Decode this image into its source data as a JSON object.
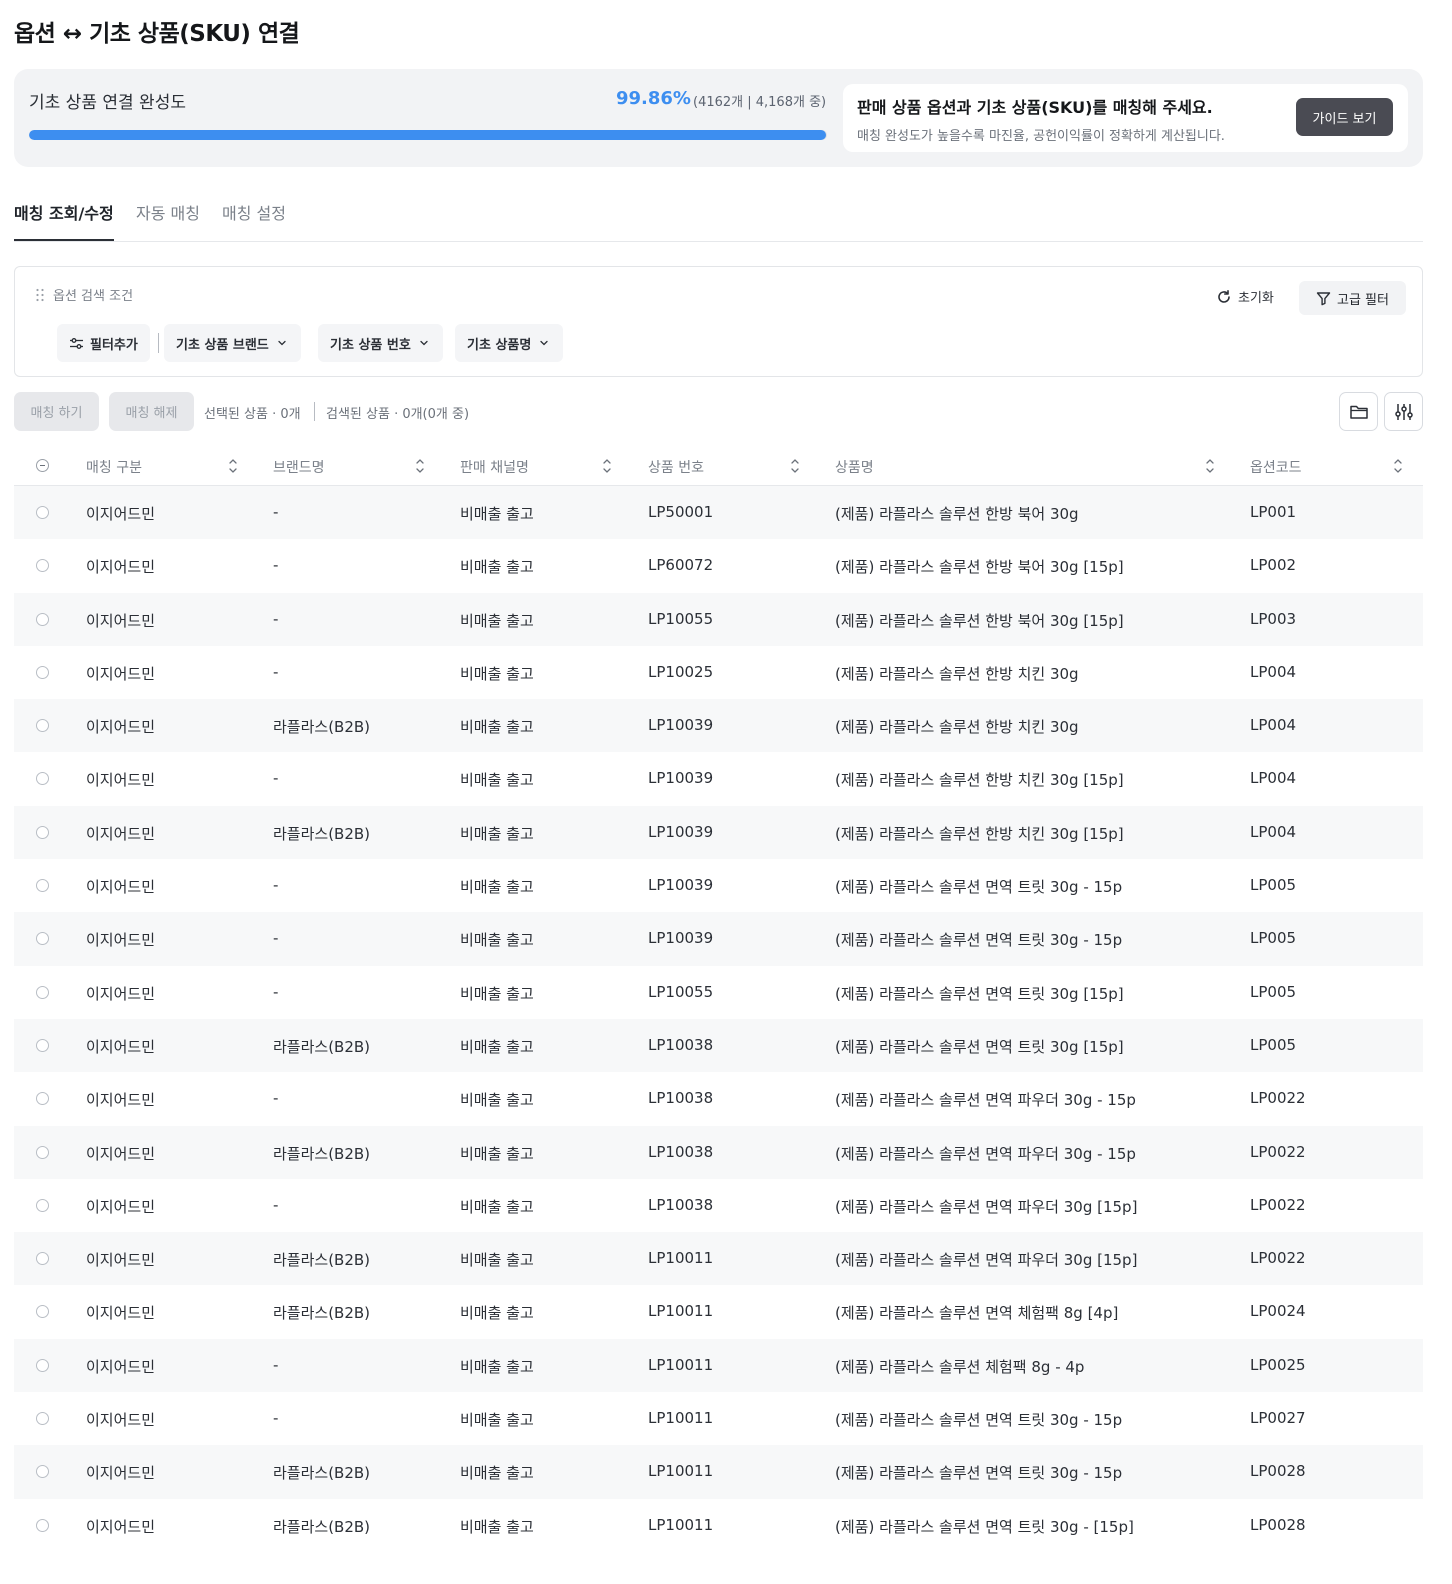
{
  "page": {
    "title": "옵션 ↔ 기초 상품(SKU) 연결"
  },
  "summary": {
    "label": "기초 상품 연결 완성도",
    "percent_text": "99.86%",
    "progress": 0.9986,
    "count_text": "(4162개 | 4,168개 중)",
    "guide_title": "판매 상품 옵션과 기초 상품(SKU)를 매칭해 주세요.",
    "guide_desc": "매칭 완성도가 높을수록 마진율, 공헌이익률이 정확하게 계산됩니다.",
    "guide_button": "가이드 보기"
  },
  "tabs": [
    {
      "label": "매칭 조회/수정",
      "active": true
    },
    {
      "label": "자동 매칭",
      "active": false
    },
    {
      "label": "매칭 설정",
      "active": false
    }
  ],
  "search": {
    "title": "옵션 검색 조건",
    "reset_label": "초기화",
    "advanced_label": "고급 필터",
    "add_filter_label": "필터추가",
    "chips": [
      "기초 상품 브랜드",
      "기초 상품 번호",
      "기초 상품명"
    ]
  },
  "actions": {
    "match_label": "매칭 하기",
    "unmatch_label": "매칭 해제",
    "selected_text": "선택된 상품 · 0개",
    "searched_text": "검색된 상품 · 0개(0개 중)"
  },
  "table": {
    "columns": [
      "매칭 구분",
      "브랜드명",
      "판매 채널명",
      "상품 번호",
      "상품명",
      "옵션코드"
    ],
    "rows": [
      [
        "이지어드민",
        "-",
        "비매출 출고",
        "LP50001",
        "(제품) 라플라스 솔루션 한방 북어 30g",
        "LP001"
      ],
      [
        "이지어드민",
        "-",
        "비매출 출고",
        "LP60072",
        "(제품) 라플라스 솔루션 한방 북어 30g [15p]",
        "LP002"
      ],
      [
        "이지어드민",
        "-",
        "비매출 출고",
        "LP10055",
        "(제품) 라플라스 솔루션 한방 북어 30g [15p]",
        "LP003"
      ],
      [
        "이지어드민",
        "-",
        "비매출 출고",
        "LP10025",
        "(제품) 라플라스 솔루션 한방 치킨 30g",
        "LP004"
      ],
      [
        "이지어드민",
        "라플라스(B2B)",
        "비매출 출고",
        "LP10039",
        "(제품) 라플라스 솔루션 한방 치킨 30g",
        "LP004"
      ],
      [
        "이지어드민",
        "-",
        "비매출 출고",
        "LP10039",
        "(제품) 라플라스 솔루션 한방 치킨 30g [15p]",
        "LP004"
      ],
      [
        "이지어드민",
        "라플라스(B2B)",
        "비매출 출고",
        "LP10039",
        "(제품) 라플라스 솔루션 한방 치킨 30g [15p]",
        "LP004"
      ],
      [
        "이지어드민",
        "-",
        "비매출 출고",
        "LP10039",
        "(제품) 라플라스 솔루션 면역 트릿 30g - 15p",
        "LP005"
      ],
      [
        "이지어드민",
        "-",
        "비매출 출고",
        "LP10039",
        "(제품) 라플라스 솔루션 면역 트릿 30g - 15p",
        "LP005"
      ],
      [
        "이지어드민",
        "-",
        "비매출 출고",
        "LP10055",
        "(제품) 라플라스 솔루션 면역 트릿 30g [15p]",
        "LP005"
      ],
      [
        "이지어드민",
        "라플라스(B2B)",
        "비매출 출고",
        "LP10038",
        "(제품) 라플라스 솔루션 면역 트릿 30g [15p]",
        "LP005"
      ],
      [
        "이지어드민",
        "-",
        "비매출 출고",
        "LP10038",
        "(제품) 라플라스 솔루션 면역 파우더 30g - 15p",
        "LP0022"
      ],
      [
        "이지어드민",
        "라플라스(B2B)",
        "비매출 출고",
        "LP10038",
        "(제품) 라플라스 솔루션 면역 파우더 30g - 15p",
        "LP0022"
      ],
      [
        "이지어드민",
        "-",
        "비매출 출고",
        "LP10038",
        "(제품) 라플라스 솔루션 면역 파우더 30g [15p]",
        "LP0022"
      ],
      [
        "이지어드민",
        "라플라스(B2B)",
        "비매출 출고",
        "LP10011",
        "(제품) 라플라스 솔루션 면역 파우더 30g [15p]",
        "LP0022"
      ],
      [
        "이지어드민",
        "라플라스(B2B)",
        "비매출 출고",
        "LP10011",
        "(제품) 라플라스 솔루션 면역 체험팩 8g [4p]",
        "LP0024"
      ],
      [
        "이지어드민",
        "-",
        "비매출 출고",
        "LP10011",
        "(제품) 라플라스 솔루션 체험팩 8g - 4p",
        "LP0025"
      ],
      [
        "이지어드민",
        "-",
        "비매출 출고",
        "LP10011",
        "(제품) 라플라스 솔루션 면역 트릿 30g - 15p",
        "LP0027"
      ],
      [
        "이지어드민",
        "라플라스(B2B)",
        "비매출 출고",
        "LP10011",
        "(제품) 라플라스 솔루션 면역 트릿 30g - 15p",
        "LP0028"
      ],
      [
        "이지어드민",
        "라플라스(B2B)",
        "비매출 출고",
        "LP10011",
        "(제품) 라플라스 솔루션 면역 트릿 30g - [15p]",
        "LP0028"
      ]
    ]
  },
  "colors": {
    "accent": "#3d8ef0",
    "guide_button": "#4a4b53",
    "zebra": "#f7f8f9"
  }
}
